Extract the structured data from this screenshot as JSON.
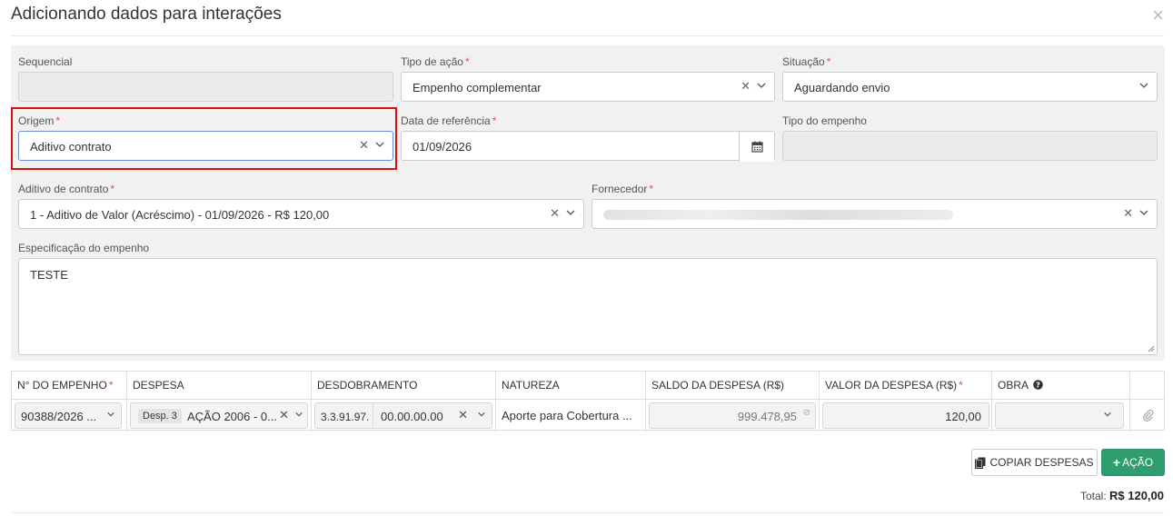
{
  "dialog": {
    "title": "Adicionando dados para interações",
    "close": "×"
  },
  "form": {
    "sequencial": {
      "label": "Sequencial",
      "value": ""
    },
    "tipo_acao": {
      "label": "Tipo de ação",
      "value": "Empenho complementar"
    },
    "situacao": {
      "label": "Situação",
      "value": "Aguardando envio"
    },
    "origem": {
      "label": "Origem",
      "value": "Aditivo contrato"
    },
    "data_referencia": {
      "label": "Data de referência",
      "value": "01/09/2026"
    },
    "tipo_empenho": {
      "label": "Tipo do empenho",
      "value": ""
    },
    "aditivo_contrato": {
      "label": "Aditivo de contrato",
      "value": "1 - Aditivo de Valor (Acréscimo) - 01/09/2026 - R$ 120,00"
    },
    "fornecedor": {
      "label": "Fornecedor",
      "value": ""
    },
    "especificacao": {
      "label": "Especificação do empenho",
      "value": "TESTE"
    },
    "required_mark": "*"
  },
  "table": {
    "headers": {
      "n_empenho": "N° DO EMPENHO",
      "despesa": "DESPESA",
      "desdobramento": "DESDOBRAMENTO",
      "natureza": "NATUREZA",
      "saldo": "SALDO DA DESPESA (R$)",
      "valor": "VALOR DA DESPESA (R$)",
      "obra": "OBRA"
    },
    "row": {
      "n_empenho": "90388/2026 ...",
      "despesa_badge": "Desp. 3",
      "despesa": "AÇÃO 2006 - 0...",
      "desdobramento_prefix": "3.3.91.97.",
      "desdobramento": "00.00.00.00",
      "natureza": "Aporte para Cobertura ...",
      "saldo": "999.478,95",
      "valor": "120,00",
      "obra": ""
    }
  },
  "actions": {
    "copy_label": "COPIAR DESPESAS",
    "add_label": "AÇÃO",
    "add_prefix": "+"
  },
  "total": {
    "label": "Total:",
    "value": "R$ 120,00"
  },
  "colors": {
    "accent_green": "#2e9e6e",
    "highlight_red": "#d91010",
    "required_red": "#d9534f"
  }
}
